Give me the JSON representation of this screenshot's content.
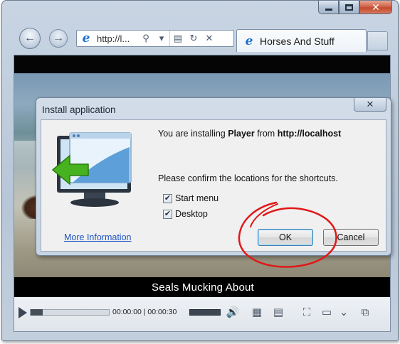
{
  "window": {
    "caption_buttons": [
      "minimize",
      "maximize",
      "close"
    ]
  },
  "toolbar": {
    "address_text": "http://l...",
    "tab_title": "Horses And Stuff"
  },
  "video": {
    "subtitle": "Seals Mucking About"
  },
  "player": {
    "time_display": "00:00:00 | 00:00:30",
    "seek_progress": 0.0,
    "volume_level": 1.0
  },
  "dialog": {
    "title": "Install application",
    "install_prefix": "You are installing ",
    "app_name": "Player",
    "install_middle": " from ",
    "source_url": "http://localhost",
    "confirm_text": "Please confirm the locations for the shortcuts.",
    "shortcuts": [
      {
        "label": "Start menu",
        "checked": true
      },
      {
        "label": "Desktop",
        "checked": true
      }
    ],
    "more_info_link": "More Information",
    "ok_label": "OK",
    "cancel_label": "Cancel"
  },
  "colors": {
    "link": "#1f55c5",
    "annotation": "#e01818",
    "close_button": "#c34a2f"
  }
}
